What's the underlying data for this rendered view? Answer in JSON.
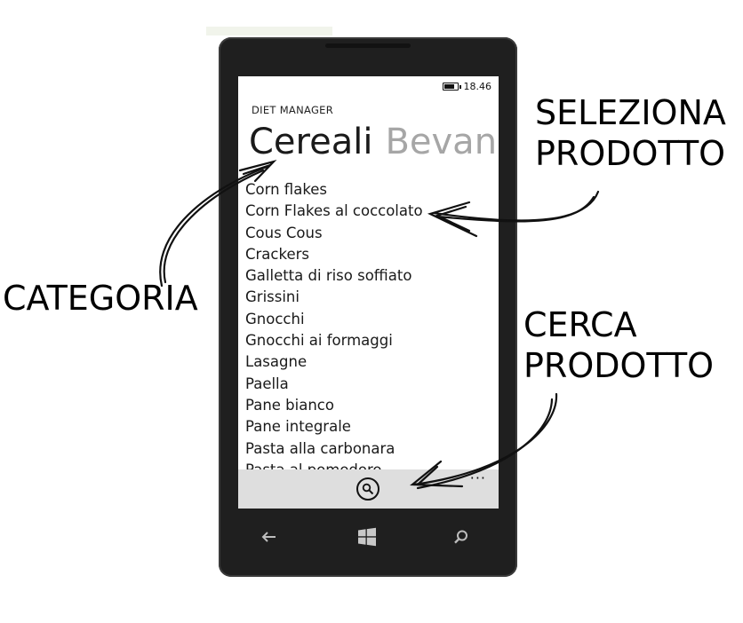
{
  "phone": {
    "status_time": "18.46",
    "app_title": "DIET MANAGER",
    "pivot": {
      "active": "Cereali",
      "inactive": "Bevand"
    },
    "products": [
      "Corn flakes",
      "Corn Flakes al coccolato",
      "Cous Cous",
      "Crackers",
      "Galletta di riso soffiato",
      "Grissini",
      "Gnocchi",
      "Gnocchi ai formaggi",
      "Lasagne",
      "Paella",
      "Pane bianco",
      "Pane integrale",
      "Pasta alla carbonara",
      "Pasta al pomodoro"
    ],
    "appbar": {
      "more": "···"
    },
    "icons": {
      "battery": "battery-icon",
      "search": "search-icon",
      "back": "back-arrow-icon",
      "windows": "windows-logo-icon",
      "nav_search": "search-icon"
    }
  },
  "callouts": {
    "seleziona": [
      "SELEZIONA",
      "PRODOTTO"
    ],
    "categoria": "CATEGORIA",
    "cerca": [
      "CERCA",
      "PRODOTTO"
    ]
  }
}
